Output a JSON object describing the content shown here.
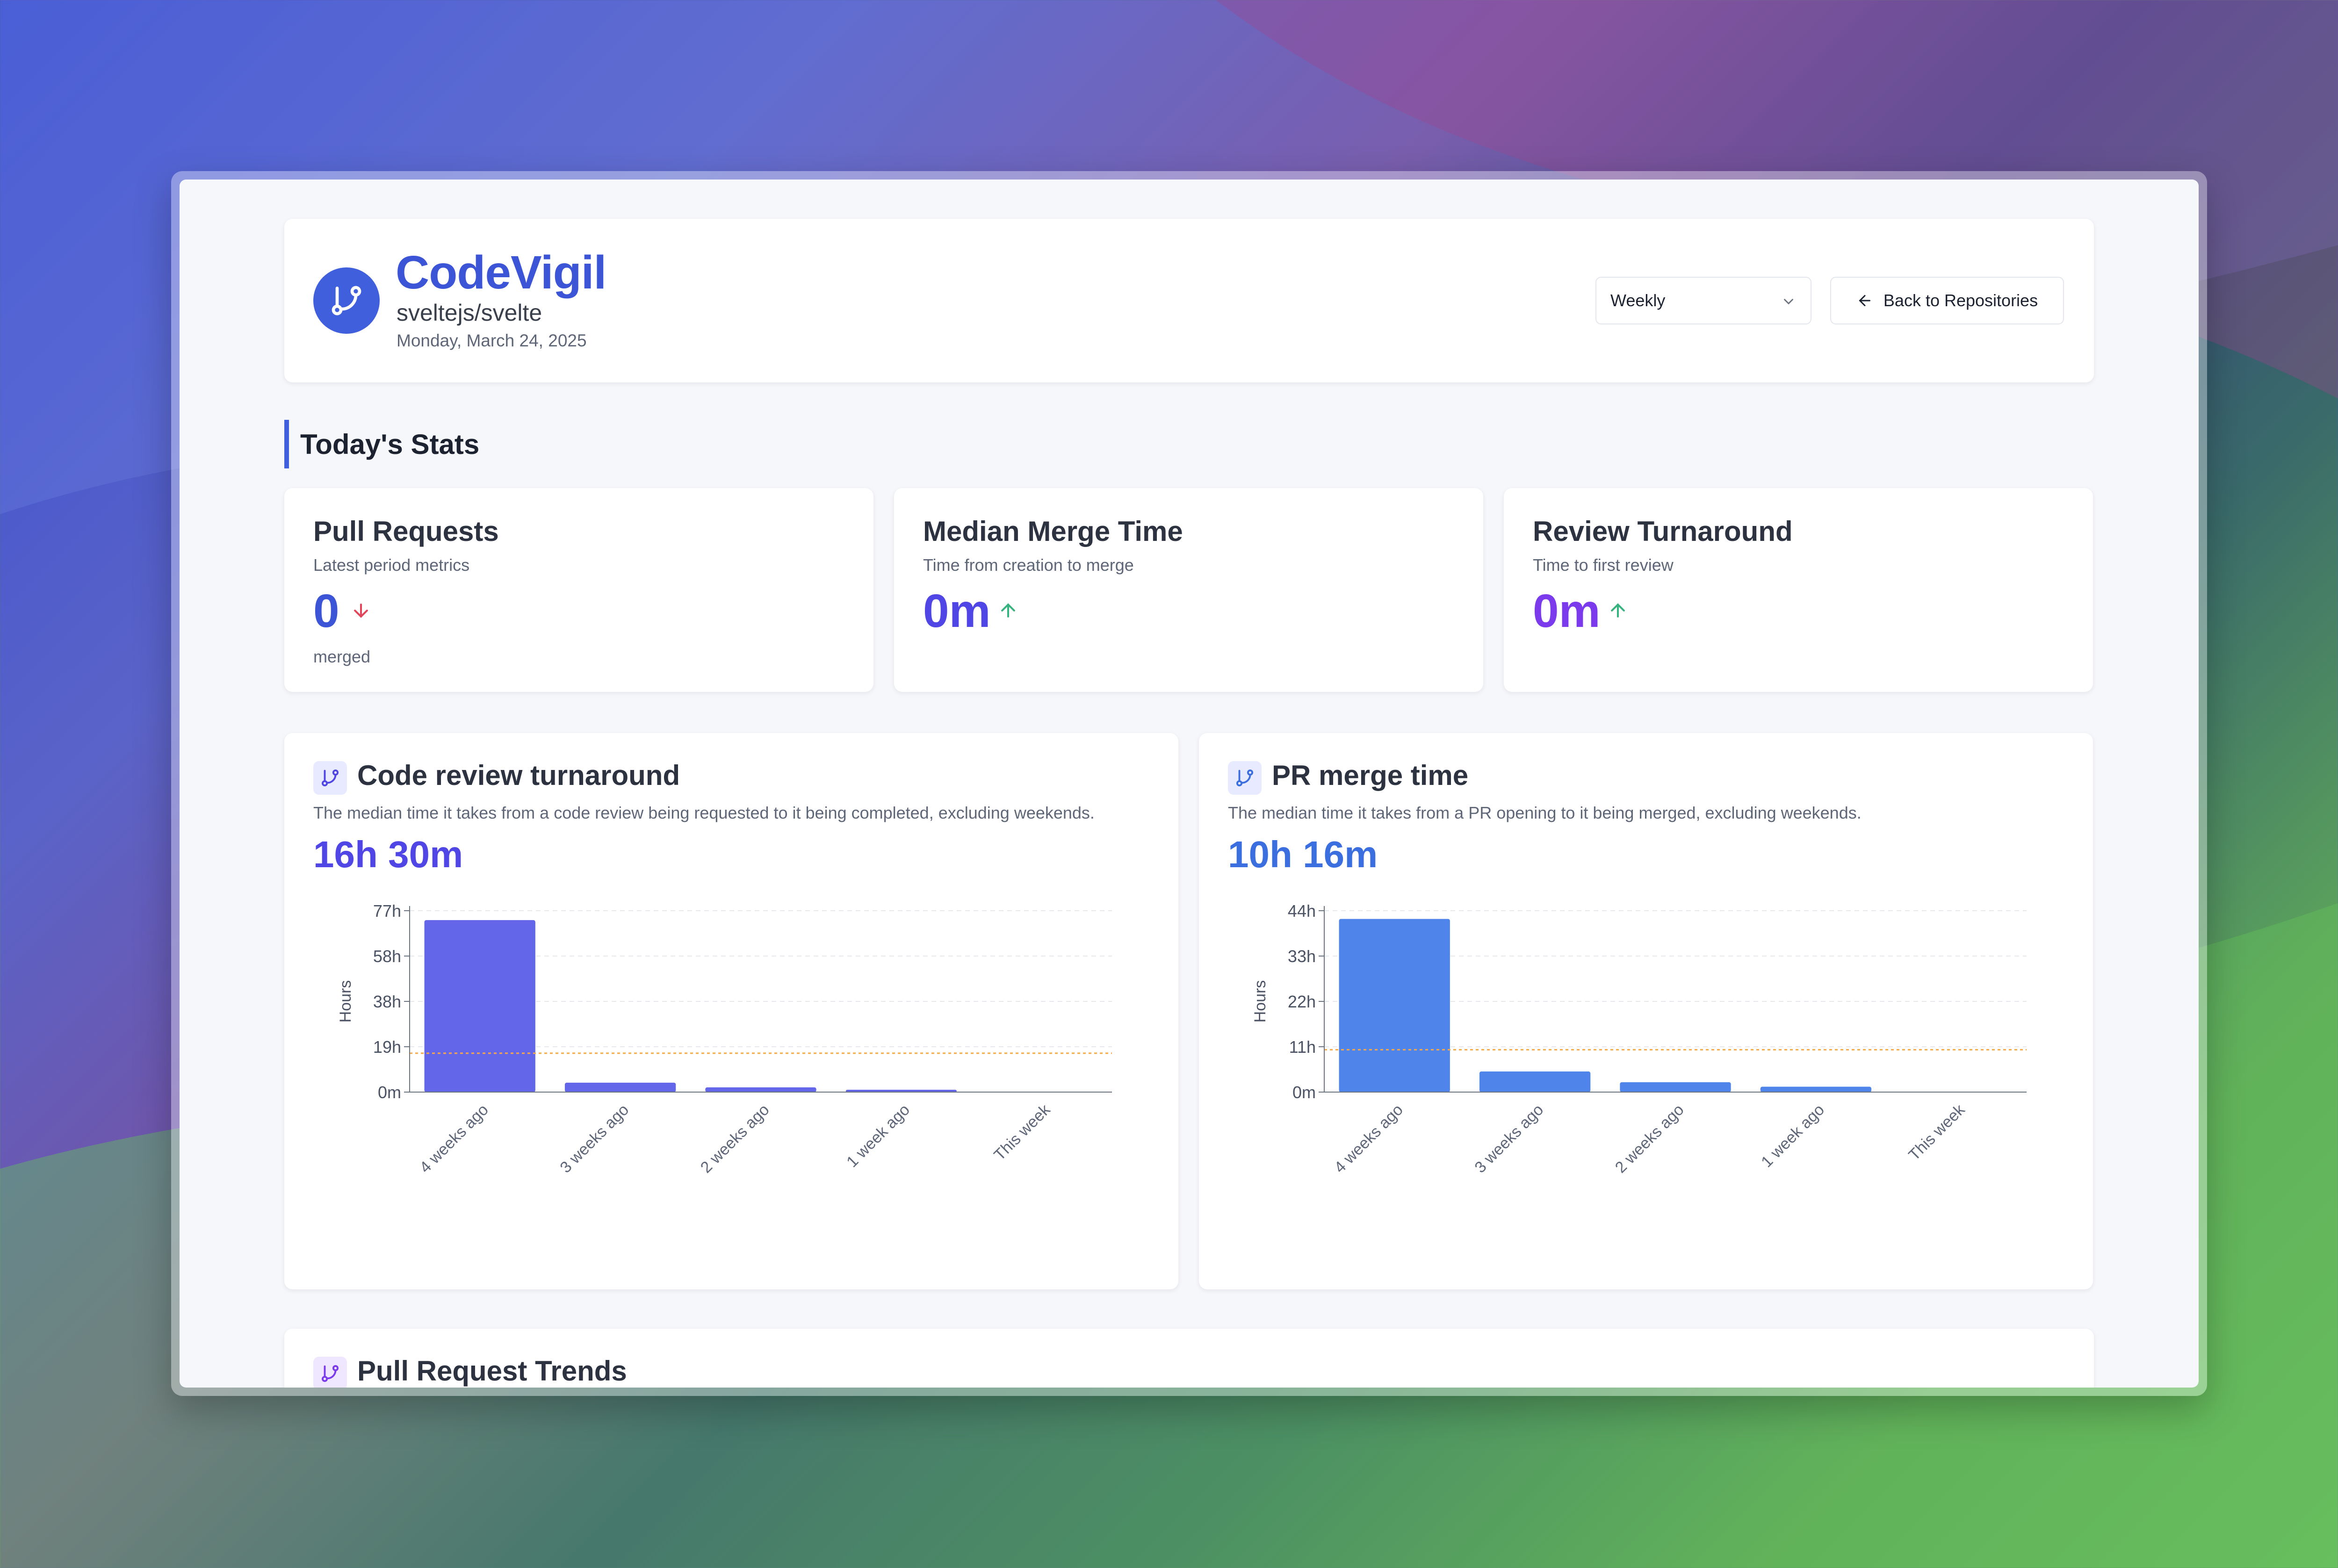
{
  "header": {
    "app_title": "CodeVigil",
    "repo": "sveltejs/svelte",
    "date": "Monday, March 24, 2025",
    "period_select": "Weekly",
    "back_button": "Back to Repositories"
  },
  "section_title": "Today's Stats",
  "stats": [
    {
      "title": "Pull Requests",
      "subtitle": "Latest period metrics",
      "value": "0",
      "unit": "merged",
      "trend": "down",
      "color": "#3c54d6"
    },
    {
      "title": "Median Merge Time",
      "subtitle": "Time from creation to merge",
      "value": "0m",
      "trend": "up",
      "color": "#4f46e5"
    },
    {
      "title": "Review Turnaround",
      "subtitle": "Time to first review",
      "value": "0m",
      "trend": "up",
      "color": "#7c3aed"
    }
  ],
  "charts": {
    "review": {
      "title": "Code review turnaround",
      "description": "The median time it takes from a code review being requested to it being completed, excluding weekends.",
      "value": "16h 30m",
      "value_color": "#4f46e5",
      "bar_color": "#6366e8"
    },
    "merge": {
      "title": "PR merge time",
      "description": "The median time it takes from a PR opening to it being merged, excluding weekends.",
      "value": "10h 16m",
      "value_color": "#3b6fe0",
      "bar_color": "#4f84ea"
    }
  },
  "trends": {
    "title": "Pull Request Trends"
  },
  "chart_data": [
    {
      "type": "bar",
      "title": "Code review turnaround",
      "categories": [
        "4 weeks ago",
        "3 weeks ago",
        "2 weeks ago",
        "1 week ago",
        "This week"
      ],
      "values": [
        73,
        4,
        2,
        1,
        0
      ],
      "ylabel": "Hours",
      "yticks": [
        "0m",
        "19h",
        "38h",
        "58h",
        "77h"
      ],
      "ylim": [
        0,
        77
      ],
      "reference_line": 16.5,
      "grid": true
    },
    {
      "type": "bar",
      "title": "PR merge time",
      "categories": [
        "4 weeks ago",
        "3 weeks ago",
        "2 weeks ago",
        "1 week ago",
        "This week"
      ],
      "values": [
        42,
        5,
        2.4,
        1.3,
        0
      ],
      "ylabel": "Hours",
      "yticks": [
        "0m",
        "11h",
        "22h",
        "33h",
        "44h"
      ],
      "ylim": [
        0,
        44
      ],
      "reference_line": 10.27,
      "grid": true
    }
  ]
}
